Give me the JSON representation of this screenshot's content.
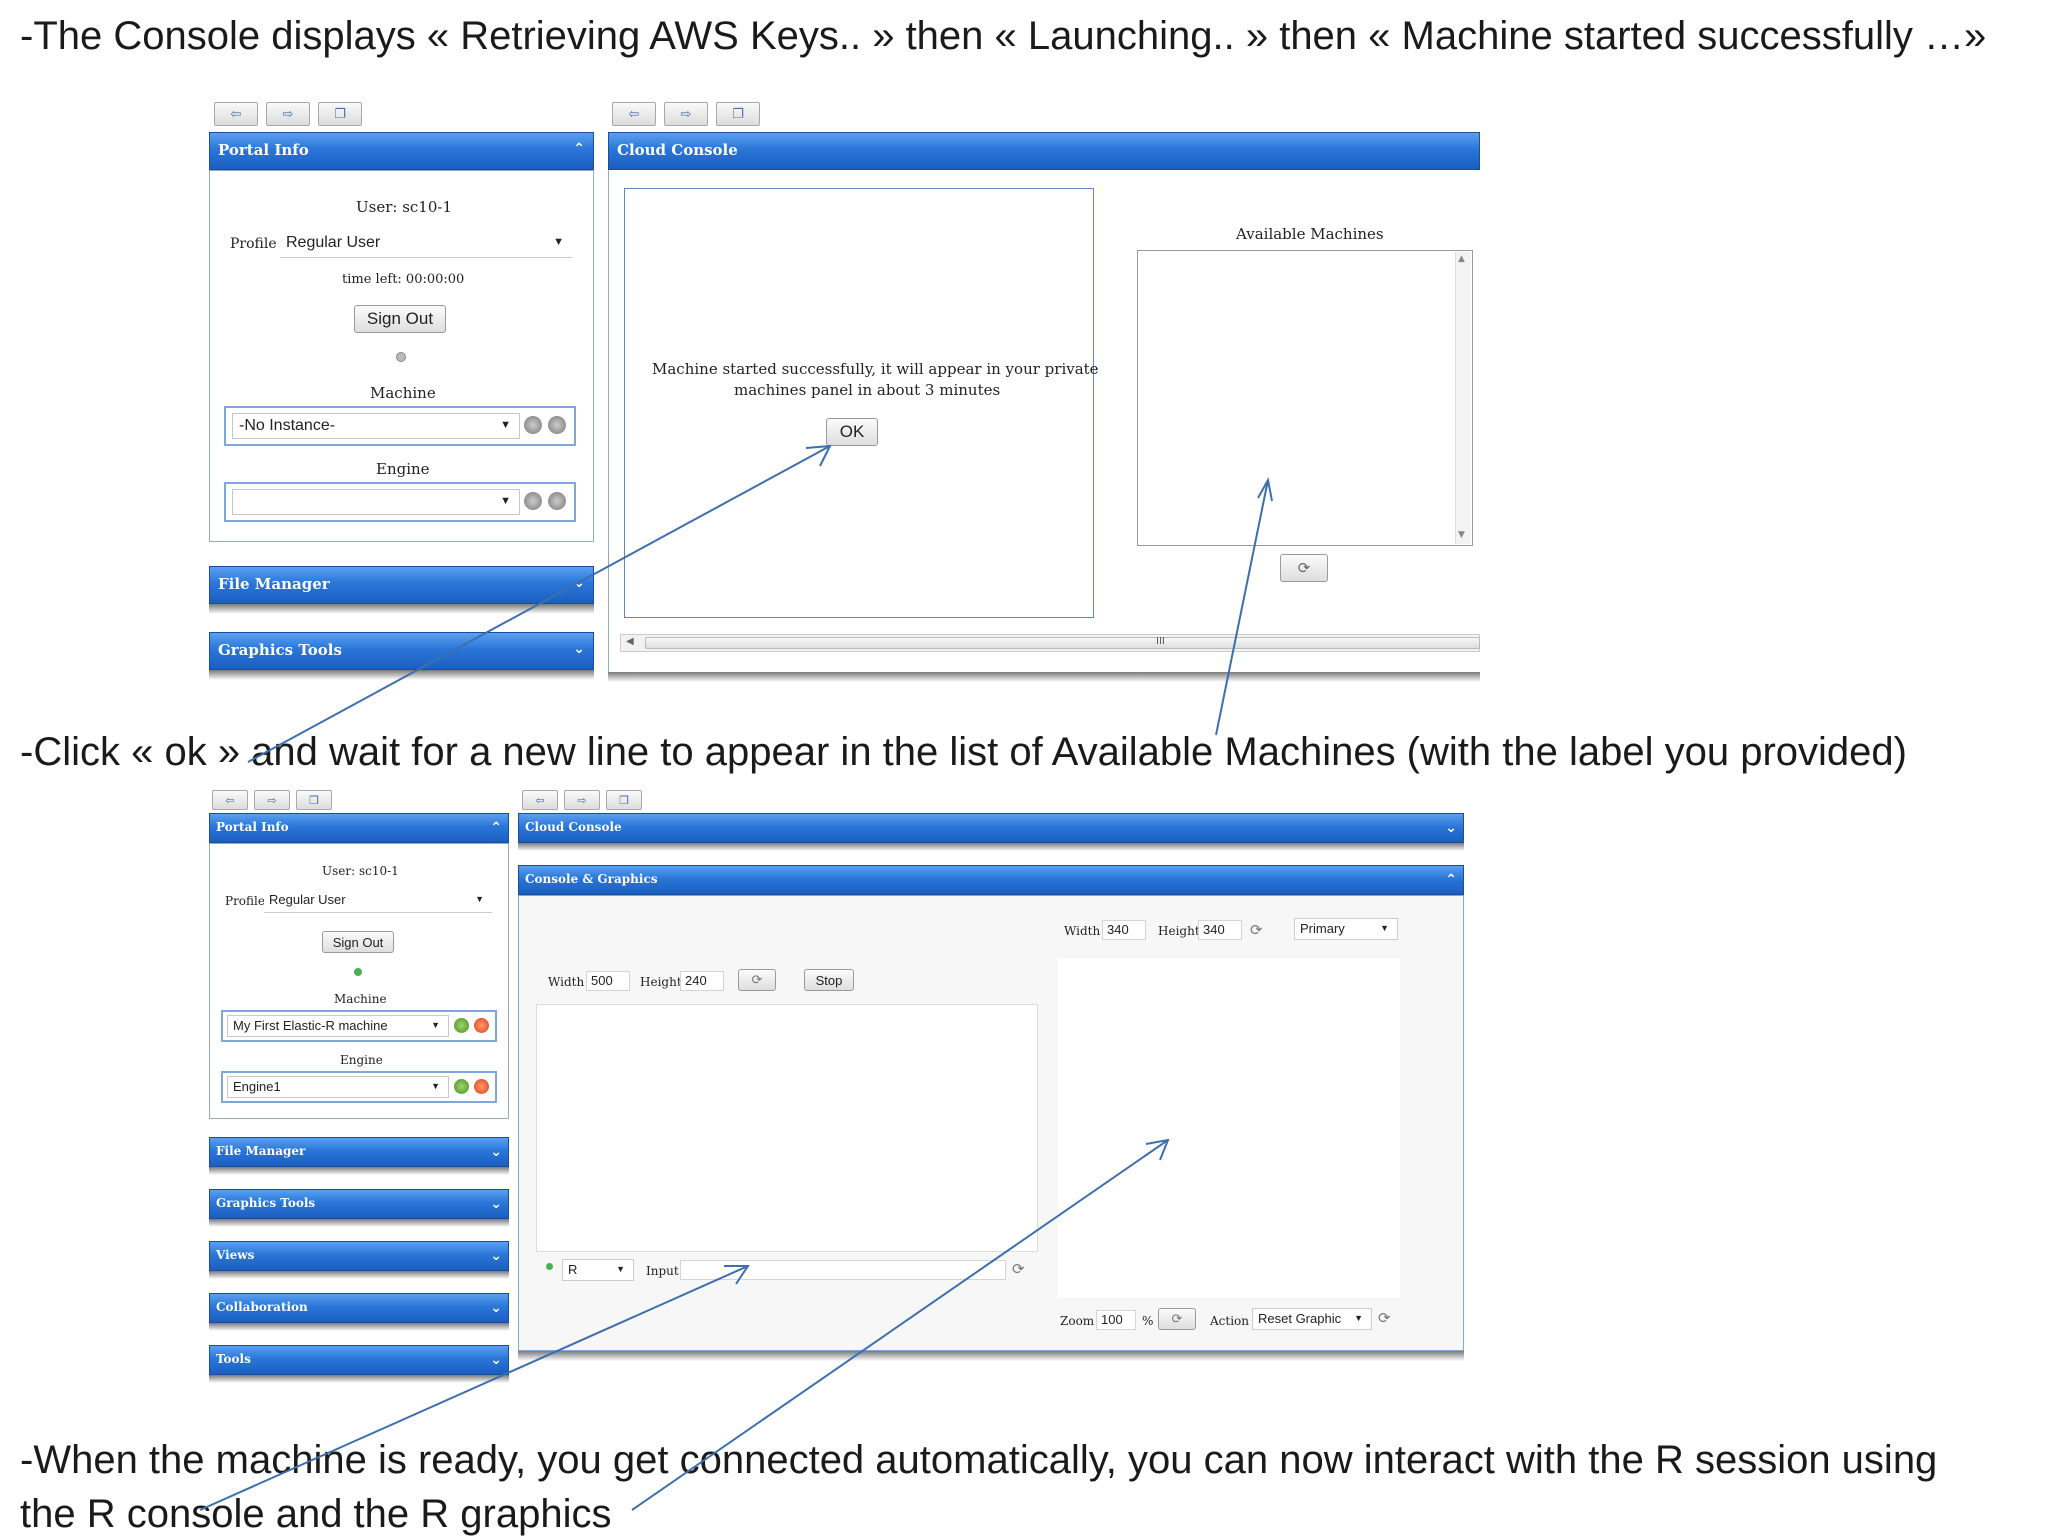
{
  "captions": {
    "top": "-The Console displays « Retrieving AWS Keys.. » then « Launching.. » then « Machine started successfully …»",
    "middle": "-Click « ok »  and wait for a new line to appear in the list of Available Machines (with the label you provided)",
    "bottom_line1": "-When the machine is ready, you get connected automatically, you can now interact with the R session using",
    "bottom_line2": "the  R console and the R graphics"
  },
  "nav": {
    "back": "⇦",
    "forward": "⇨",
    "restore": "❐"
  },
  "screen1": {
    "portal": {
      "title": "Portal Info",
      "user": "User: sc10-1",
      "profile_label": "Profile",
      "profile_value": "Regular User",
      "time_left": "time left: 00:00:00",
      "sign_out": "Sign Out",
      "machine_label": "Machine",
      "machine_value": "-No Instance-",
      "engine_label": "Engine",
      "engine_value": ""
    },
    "file_manager": "File Manager",
    "graphics_tools": "Graphics Tools",
    "console": {
      "title": "Cloud Console",
      "message_line1": "Machine started successfully, it will appear in your private",
      "message_line2": "machines panel in about 3 minutes",
      "ok": "OK",
      "available_machines": "Available Machines",
      "scroll_mid": "III"
    }
  },
  "screen2": {
    "portal": {
      "title": "Portal Info",
      "user": "User: sc10-1",
      "profile_label": "Profile",
      "profile_value": "Regular User",
      "sign_out": "Sign Out",
      "machine_label": "Machine",
      "machine_value": "My First Elastic-R machine",
      "engine_label": "Engine",
      "engine_value": "Engine1"
    },
    "side_panels": [
      "File Manager",
      "Graphics Tools",
      "Views",
      "Collaboration",
      "Tools"
    ],
    "cloud_console": "Cloud Console",
    "console_graphics": {
      "title": "Console & Graphics",
      "left_width_label": "Width",
      "left_width": "500",
      "left_height_label": "Height",
      "left_height": "240",
      "stop": "Stop",
      "right_width_label": "Width",
      "right_width": "340",
      "right_height_label": "Height",
      "right_height": "340",
      "device": "Primary",
      "lang": "R",
      "input_label": "Input",
      "zoom_label": "Zoom",
      "zoom": "100",
      "percent": "%",
      "action_label": "Action",
      "action": "Reset Graphic"
    }
  },
  "colors": {
    "header_blue": "#2a76d8",
    "arrow": "#3d6fae",
    "status_green": "#4caf50",
    "status_red": "#e0522a"
  }
}
